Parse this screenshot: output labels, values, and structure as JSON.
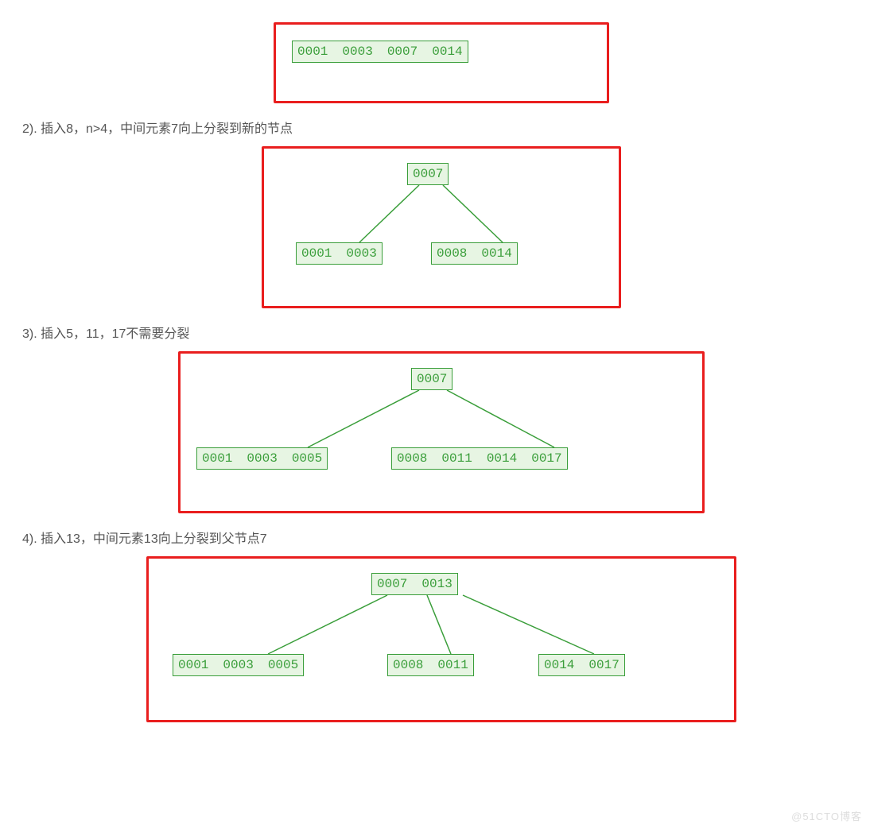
{
  "steps": {
    "s2": "2). 插入8，n>4，中间元素7向上分裂到新的节点",
    "s3": "3). 插入5，11，17不需要分裂",
    "s4": "4). 插入13，中间元素13向上分裂到父节点7"
  },
  "d1": {
    "root": [
      "0001",
      "0003",
      "0007",
      "0014"
    ]
  },
  "d2": {
    "root": [
      "0007"
    ],
    "left": [
      "0001",
      "0003"
    ],
    "right": [
      "0008",
      "0014"
    ]
  },
  "d3": {
    "root": [
      "0007"
    ],
    "left": [
      "0001",
      "0003",
      "0005"
    ],
    "right": [
      "0008",
      "0011",
      "0014",
      "0017"
    ]
  },
  "d4": {
    "root": [
      "0007",
      "0013"
    ],
    "left": [
      "0001",
      "0003",
      "0005"
    ],
    "mid": [
      "0008",
      "0011"
    ],
    "right": [
      "0014",
      "0017"
    ]
  },
  "watermark": "@51CTO博客"
}
